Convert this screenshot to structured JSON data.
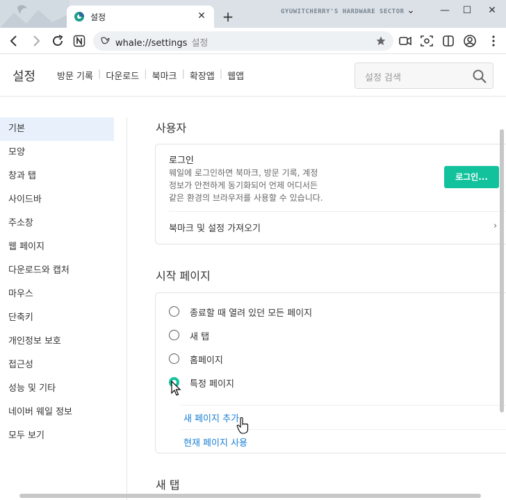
{
  "window": {
    "tab_title": "설정",
    "watermark": "GYUWITCHERRY'S HARDWARE SECTOR",
    "colors": {
      "accent": "#12c29c",
      "link": "#1a7fd4",
      "active_bg": "#e8f1fb"
    }
  },
  "address_bar": {
    "url": "whale://settings",
    "page_label": "설정"
  },
  "header": {
    "title": "설정",
    "links": [
      "방문 기록",
      "다운로드",
      "북마크",
      "확장앱",
      "웹앱"
    ],
    "search_placeholder": "설정 검색"
  },
  "sidebar": {
    "items": [
      {
        "label": "기본",
        "active": true
      },
      {
        "label": "모양"
      },
      {
        "label": "창과 탭"
      },
      {
        "label": "사이드바"
      },
      {
        "label": "주소창"
      },
      {
        "label": "웹 페이지"
      },
      {
        "label": "다운로드와 캡처"
      },
      {
        "label": "마우스"
      },
      {
        "label": "단축키"
      },
      {
        "label": "개인정보 보호"
      },
      {
        "label": "접근성"
      },
      {
        "label": "성능 및 기타"
      },
      {
        "label": "네이버 웨일 정보"
      },
      {
        "label": "모두 보기"
      }
    ]
  },
  "main": {
    "user_section": {
      "title": "사용자",
      "login_title": "로그인",
      "login_desc": [
        "웨일에 로그인하면 북마크, 방문 기록, 계정",
        "정보가 안전하게 동기화되어 언제 어디서든",
        "같은 환경의 브라우저를 사용할 수 있습니다."
      ],
      "login_button": "로그인...",
      "import_label": "북마크 및 설정 가져오기"
    },
    "start_section": {
      "title": "시작 페이지",
      "options": [
        {
          "label": "종료할 때 열려 있던 모든 페이지",
          "checked": false
        },
        {
          "label": "새 탭",
          "checked": false
        },
        {
          "label": "홈페이지",
          "checked": false
        },
        {
          "label": "특정 페이지",
          "checked": true
        }
      ],
      "add_page_link": "새 페이지 추가",
      "use_current_link": "현재 페이지 사용"
    },
    "newtab_section": {
      "title": "새 탭"
    }
  }
}
